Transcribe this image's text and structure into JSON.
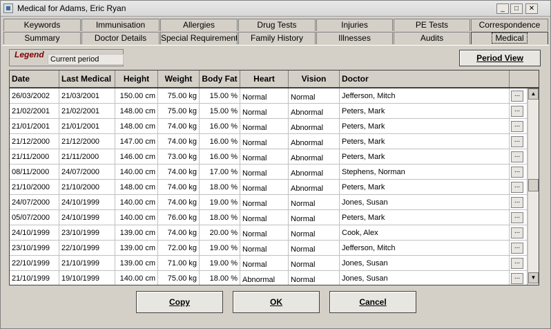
{
  "window": {
    "title": "Medical for Adams, Eric Ryan",
    "min_label": "_",
    "max_label": "□",
    "close_label": "✕"
  },
  "tabs_row1": [
    "Keywords",
    "Immunisation",
    "Allergies",
    "Drug Tests",
    "Injuries",
    "PE Tests",
    "Correspondence"
  ],
  "tabs_row2": [
    "Summary",
    "Doctor Details",
    "Special Requirements",
    "Family History",
    "Illnesses",
    "Audits",
    "Medical"
  ],
  "active_tab": "Medical",
  "legend": {
    "title": "Legend",
    "item": "Current period"
  },
  "period_view_label": "Period View",
  "columns": [
    "Date",
    "Last Medical",
    "Height",
    "Weight",
    "Body Fat",
    "Heart",
    "Vision",
    "Doctor"
  ],
  "rows": [
    [
      "26/03/2002",
      "21/03/2001",
      "150.00 cm",
      "75.00 kg",
      "15.00 %",
      "Normal",
      "Normal",
      "Jefferson, Mitch"
    ],
    [
      "21/02/2001",
      "21/02/2001",
      "148.00 cm",
      "75.00 kg",
      "15.00 %",
      "Normal",
      "Abnormal",
      "Peters, Mark"
    ],
    [
      "21/01/2001",
      "21/01/2001",
      "148.00 cm",
      "74.00 kg",
      "16.00 %",
      "Normal",
      "Abnormal",
      "Peters, Mark"
    ],
    [
      "21/12/2000",
      "21/12/2000",
      "147.00 cm",
      "74.00 kg",
      "16.00 %",
      "Normal",
      "Abnormal",
      "Peters, Mark"
    ],
    [
      "21/11/2000",
      "21/11/2000",
      "146.00 cm",
      "73.00 kg",
      "16.00 %",
      "Normal",
      "Abnormal",
      "Peters, Mark"
    ],
    [
      "08/11/2000",
      "24/07/2000",
      "140.00 cm",
      "74.00 kg",
      "17.00 %",
      "Normal",
      "Abnormal",
      "Stephens, Norman"
    ],
    [
      "21/10/2000",
      "21/10/2000",
      "148.00 cm",
      "74.00 kg",
      "18.00 %",
      "Normal",
      "Abnormal",
      "Peters, Mark"
    ],
    [
      "24/07/2000",
      "24/10/1999",
      "140.00 cm",
      "74.00 kg",
      "19.00 %",
      "Normal",
      "Normal",
      "Jones, Susan"
    ],
    [
      "05/07/2000",
      "24/10/1999",
      "140.00 cm",
      "76.00 kg",
      "18.00 %",
      "Normal",
      "Normal",
      "Peters, Mark"
    ],
    [
      "24/10/1999",
      "23/10/1999",
      "139.00 cm",
      "74.00 kg",
      "20.00 %",
      "Normal",
      "Normal",
      "Cook, Alex"
    ],
    [
      "23/10/1999",
      "22/10/1999",
      "139.00 cm",
      "72.00 kg",
      "19.00 %",
      "Normal",
      "Normal",
      "Jefferson, Mitch"
    ],
    [
      "22/10/1999",
      "21/10/1999",
      "139.00 cm",
      "71.00 kg",
      "19.00 %",
      "Normal",
      "Normal",
      "Jones, Susan"
    ],
    [
      "21/10/1999",
      "19/10/1999",
      "140.00 cm",
      "75.00 kg",
      "18.00 %",
      "Abnormal",
      "Normal",
      "Jones, Susan"
    ]
  ],
  "row_button_label": "...",
  "buttons": {
    "copy": "Copy",
    "ok": "OK",
    "cancel": "Cancel"
  }
}
